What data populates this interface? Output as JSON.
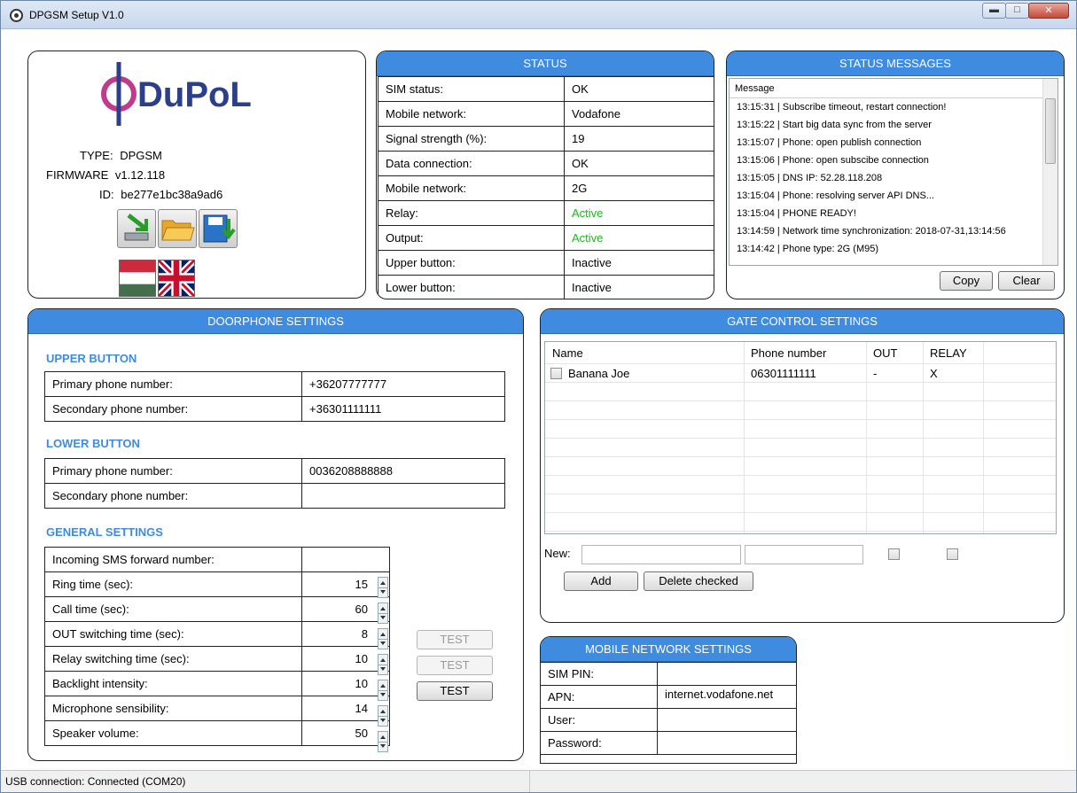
{
  "window": {
    "title": "DPGSM Setup V1.0"
  },
  "info": {
    "logo_text": "DuPoL",
    "type_label": "TYPE:",
    "type_value": "DPGSM",
    "firmware_label": "FIRMWARE",
    "firmware_value": "v1.12.118",
    "id_label": "ID:",
    "id_value": "be277e1bc38a9ad6",
    "toolbar_icons": [
      "download-to-device-icon",
      "open-folder-icon",
      "save-disk-icon"
    ],
    "language_flags": [
      "hungarian-flag-icon",
      "uk-flag-icon"
    ]
  },
  "status": {
    "title": "STATUS",
    "rows": [
      {
        "label": "SIM status:",
        "value": "OK"
      },
      {
        "label": "Mobile network:",
        "value": "Vodafone"
      },
      {
        "label": "Signal strength (%):",
        "value": "19"
      },
      {
        "label": "Data connection:",
        "value": "OK"
      },
      {
        "label": "Mobile network:",
        "value": "2G"
      },
      {
        "label": "Relay:",
        "value": "Active"
      },
      {
        "label": "Output:",
        "value": "Active"
      },
      {
        "label": "Upper button:",
        "value": "Inactive"
      },
      {
        "label": "Lower button:",
        "value": "Inactive"
      }
    ],
    "active_color": "#1fb81f"
  },
  "status_messages": {
    "title": "STATUS MESSAGES",
    "column": "Message",
    "messages": [
      "13:15:31 | Subscribe timeout, restart connection!",
      "13:15:22 | Start big data sync from the server",
      "13:15:07 | Phone: open publish connection",
      "13:15:06 | Phone: open subscibe connection",
      "13:15:05 | DNS IP: 52.28.118.208",
      "13:15:04 | Phone: resolving server API DNS...",
      "13:15:04 | PHONE READY!",
      "13:14:59 | Network time synchronization: 2018-07-31,13:14:56",
      "13:14:42 | Phone type: 2G (M95)"
    ],
    "copy_label": "Copy",
    "clear_label": "Clear"
  },
  "doorphone": {
    "title": "DOORPHONE SETTINGS",
    "upper": {
      "title": "UPPER BUTTON",
      "primary_label": "Primary phone number:",
      "primary_value": "+36207777777",
      "secondary_label": "Secondary phone number:",
      "secondary_value": "+36301111111"
    },
    "lower": {
      "title": "LOWER BUTTON",
      "primary_label": "Primary phone number:",
      "primary_value": "0036208888888",
      "secondary_label": "Secondary phone number:",
      "secondary_value": ""
    },
    "general": {
      "title": "GENERAL SETTINGS",
      "sms_label": "Incoming SMS forward number:",
      "sms_value": "",
      "ring_label": "Ring time (sec):",
      "ring_value": "15",
      "call_label": "Call time (sec):",
      "call_value": "60",
      "out_label": "OUT switching time (sec):",
      "out_value": "8",
      "relay_label": "Relay switching time (sec):",
      "relay_value": "10",
      "backlight_label": "Backlight intensity:",
      "backlight_value": "10",
      "mic_label": "Microphone sensibility:",
      "mic_value": "14",
      "speaker_label": "Speaker volume:",
      "speaker_value": "50",
      "test_label": "TEST"
    }
  },
  "gate": {
    "title": "GATE CONTROL SETTINGS",
    "columns": [
      "Name",
      "Phone number",
      "OUT",
      "RELAY"
    ],
    "rows": [
      {
        "name": "Banana Joe",
        "phone": "06301111111",
        "out": "-",
        "relay": "X"
      }
    ],
    "new_label": "New:",
    "add_label": "Add",
    "delete_label": "Delete checked"
  },
  "mobile": {
    "title": "MOBILE NETWORK SETTINGS",
    "pin_label": "SIM PIN:",
    "pin_value": "",
    "apn_label": "APN:",
    "apn_value": "internet.vodafone.net",
    "user_label": "User:",
    "user_value": "",
    "password_label": "Password:",
    "password_value": ""
  },
  "statusbar": {
    "text": "USB connection:  Connected (COM20)"
  }
}
